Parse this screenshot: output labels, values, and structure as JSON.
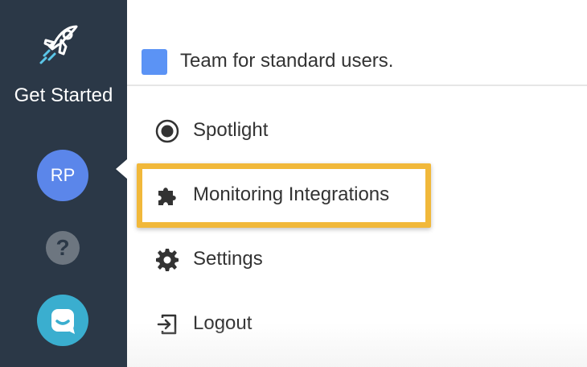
{
  "sidebar": {
    "get_started_label": "Get Started",
    "avatar_initials": "RP",
    "icons": {
      "launch": "rocket-icon",
      "help": "help-icon",
      "chat": "chat-icon"
    },
    "colors": {
      "background": "#2b3847",
      "avatar": "#5b86ea",
      "chat": "#3aaecf",
      "rocket": "#ffffff",
      "rocket_accent": "#5bc6e8"
    }
  },
  "menu": {
    "team": {
      "name": "Team for standard users.",
      "color": "#5b93f5"
    },
    "items": [
      {
        "label": "Spotlight",
        "icon": "radio-target-icon"
      },
      {
        "label": "Monitoring Integrations",
        "icon": "puzzle-piece-icon",
        "highlighted": true
      },
      {
        "label": "Settings",
        "icon": "gear-icon"
      },
      {
        "label": "Logout",
        "icon": "logout-icon"
      }
    ],
    "highlight_color": "#f1b83a"
  }
}
